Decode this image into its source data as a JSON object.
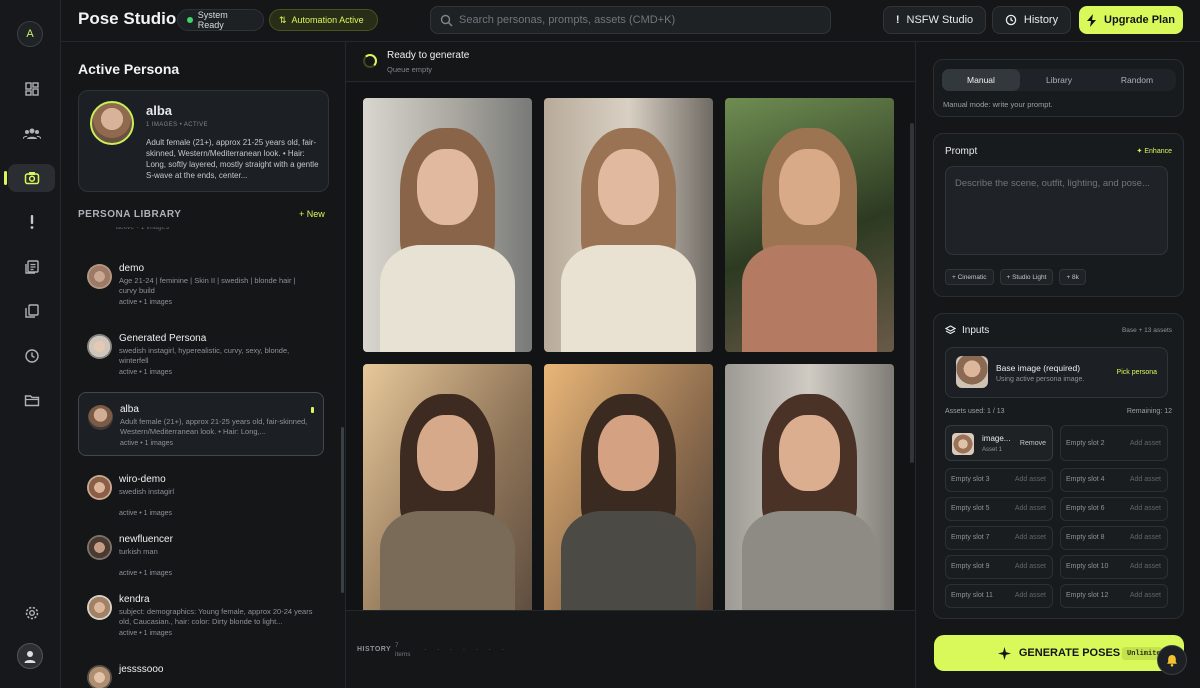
{
  "app": {
    "title": "Pose Studio",
    "system_status": "System Ready",
    "automation_status": "Automation Active",
    "search_placeholder": "Search personas, prompts, assets (CMD+K)",
    "nsfw_label": "NSFW Studio",
    "history_label": "History",
    "upgrade_label": "Upgrade Plan",
    "logo_letter": "A",
    "colors": {
      "accent": "#d9f95a",
      "bg": "#121416",
      "panel": "#181b1e"
    }
  },
  "rail": {
    "icons": [
      "dashboard-icon",
      "users-icon",
      "camera-icon",
      "alert-icon",
      "document-icon",
      "copy-icon",
      "clock-icon",
      "folder-icon",
      "settings-icon"
    ]
  },
  "active_persona": {
    "heading": "Active Persona",
    "name": "alba",
    "meta": "1 IMAGES • ACTIVE",
    "description": "Adult female (21+), approx 21-25 years old, fair-skinned, Western/Mediterranean look. • Hair: Long, softly layered, mostly straight with a gentle S-wave at the ends, center..."
  },
  "library": {
    "heading": "PERSONA LIBRARY",
    "new_label": "+ New",
    "cut_meta": "active • 1 images",
    "items": [
      {
        "name": "demo",
        "desc": "Age 21-24 | feminine | Skin II | swedish | blonde hair | curvy build",
        "meta": "active • 1 images"
      },
      {
        "name": "Generated Persona",
        "desc": "swedish instagirl, hyperealistic, curvy, sexy, blonde, winterfell",
        "meta": "active • 1 images"
      },
      {
        "name": "alba",
        "desc": "Adult female (21+), approx 21-25 years old, fair-skinned, Western/Mediterranean look. • Hair: Long,...",
        "meta": "active • 1 images"
      },
      {
        "name": "wiro-demo",
        "desc": "swedish instagirl",
        "meta": "active • 1 images"
      },
      {
        "name": "newfluencer",
        "desc": "turkish man",
        "meta": "active • 1 images"
      },
      {
        "name": "kendra",
        "desc": "subject: demographics: Young female, approx 20-24 years old, Caucasian., hair: color: Dirty blonde to light...",
        "meta": "active • 1 images"
      },
      {
        "name": "jessssooo",
        "desc": "",
        "meta": ""
      }
    ]
  },
  "center": {
    "status_title": "Ready to generate",
    "status_sub": "Queue empty",
    "history_label": "HISTORY",
    "history_count": "7",
    "history_items_label": "items",
    "history_dots": "· · · · · · ·"
  },
  "right": {
    "mode_tabs": [
      "Manual",
      "Library",
      "Random"
    ],
    "mode_hint": "Manual mode: write your prompt.",
    "prompt_title": "Prompt",
    "enhance_label": "Enhance",
    "prompt_placeholder": "Describe the scene, outfit, lighting, and pose...",
    "chips": [
      "+ Cinematic",
      "+ Studio Light",
      "+ 8k"
    ],
    "inputs_title": "Inputs",
    "inputs_count": "Base + 13 assets",
    "base_title": "Base image (required)",
    "base_sub": "Using active persona image.",
    "pick_label": "Pick persona",
    "assets_used": "Assets used: 1 / 13",
    "remaining": "Remaining: 12",
    "filled_slot": {
      "name": "image...",
      "sub": "Asset 1",
      "remove": "Remove"
    },
    "add_label": "Add asset",
    "slots": [
      "Empty slot 2",
      "Empty slot 3",
      "Empty slot 4",
      "Empty slot 5",
      "Empty slot 6",
      "Empty slot 7",
      "Empty slot 8",
      "Empty slot 9",
      "Empty slot 10",
      "Empty slot 11",
      "Empty slot 12"
    ],
    "generate_label": "GENERATE POSES",
    "unlimited_label": "Unlimited"
  }
}
